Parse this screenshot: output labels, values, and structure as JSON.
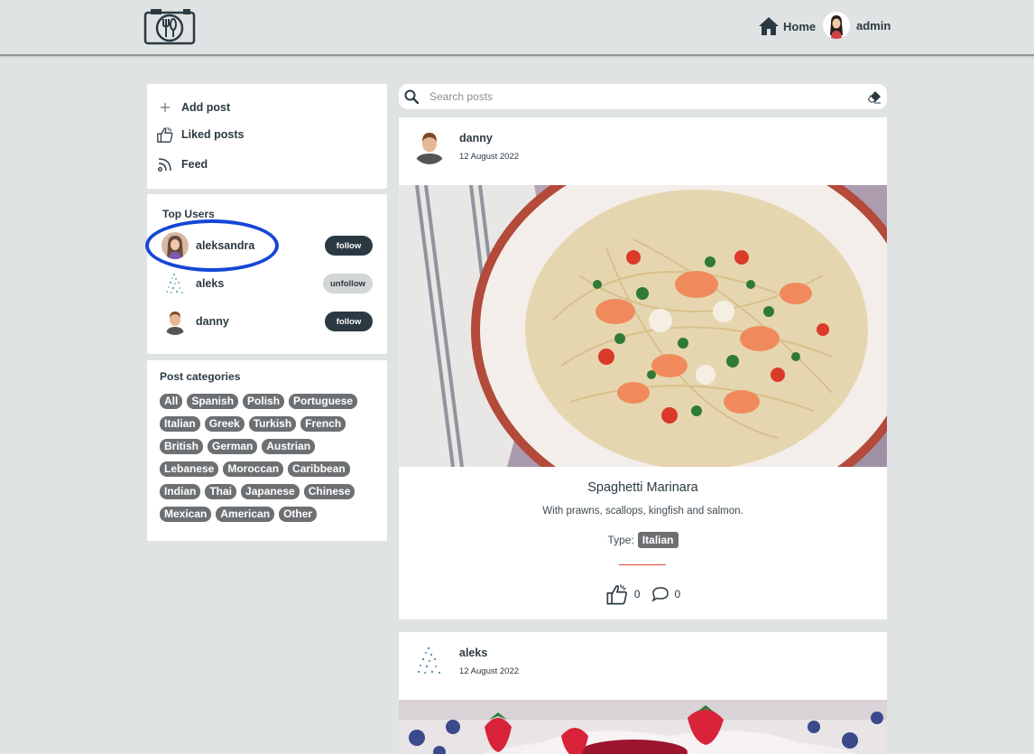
{
  "header": {
    "home_label": "Home",
    "user_label": "admin"
  },
  "menu": {
    "items": [
      {
        "label": "Add post",
        "icon": "plus-icon"
      },
      {
        "label": "Liked posts",
        "icon": "thumbs-up-icon"
      },
      {
        "label": "Feed",
        "icon": "rss-icon"
      }
    ]
  },
  "top_users": {
    "title": "Top Users",
    "users": [
      {
        "name": "aleksandra",
        "action": "follow"
      },
      {
        "name": "aleks",
        "action": "unfollow"
      },
      {
        "name": "danny",
        "action": "follow"
      }
    ]
  },
  "categories": {
    "title": "Post categories",
    "items": [
      "All",
      "Spanish",
      "Polish",
      "Portuguese",
      "Italian",
      "Greek",
      "Turkish",
      "French",
      "British",
      "German",
      "Austrian",
      "Lebanese",
      "Moroccan",
      "Caribbean",
      "Indian",
      "Thai",
      "Japanese",
      "Chinese",
      "Mexican",
      "American",
      "Other"
    ]
  },
  "search": {
    "placeholder": "Search posts"
  },
  "posts": [
    {
      "author": "danny",
      "date": "12 August 2022",
      "title": "Spaghetti Marinara",
      "description": "With prawns, scallops, kingfish and salmon.",
      "type_label": "Type:",
      "type": "Italian",
      "likes": "0",
      "comments": "0"
    },
    {
      "author": "aleks",
      "date": "12 August 2022"
    }
  ],
  "colors": {
    "accent": "#2b3a42",
    "chip": "#6d7073",
    "highlight": "#1546d6",
    "divider": "#e2423a"
  }
}
